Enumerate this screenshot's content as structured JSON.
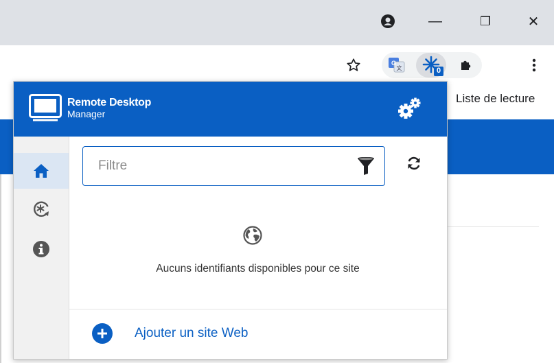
{
  "browser": {
    "window_controls": {
      "minimize": "—",
      "restore": "❐",
      "close": "✕"
    },
    "toolbar": {
      "extension_badge": "0"
    },
    "bookmarks_bar": {
      "reading_list": "Liste de lecture"
    }
  },
  "popup": {
    "logo": {
      "line1": "Remote Desktop",
      "line2": "Manager"
    },
    "search": {
      "placeholder": "Filtre",
      "value": ""
    },
    "empty_message": "Aucuns identifiants disponibles pour ce site",
    "add_site_label": "Ajouter un site Web"
  },
  "colors": {
    "brand_blue": "#0a5fc3",
    "sidebar_bg": "#f1f1f1",
    "sidebar_active": "#dbe6f3",
    "chrome_titlebar": "#dee1e6"
  },
  "icons": {
    "titlebar": [
      "profile-icon",
      "minimize-icon",
      "restore-icon",
      "close-icon"
    ],
    "toolbar": [
      "bookmark-star-icon",
      "translate-icon",
      "rdm-extension-icon",
      "extensions-puzzle-icon",
      "chrome-menu-icon"
    ],
    "popup": [
      "rdm-logo-icon",
      "settings-gears-icon",
      "home-icon",
      "generator-icon",
      "info-icon",
      "filter-funnel-icon",
      "refresh-icon",
      "globe-icon",
      "add-circle-icon"
    ]
  }
}
